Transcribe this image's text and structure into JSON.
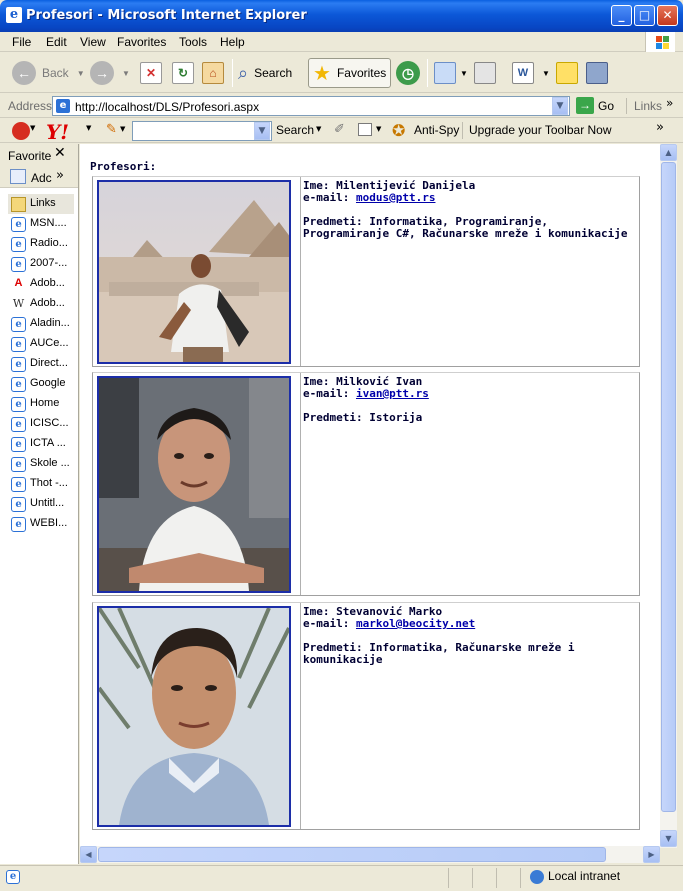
{
  "window": {
    "title": "Profesori - Microsoft Internet Explorer"
  },
  "menu": {
    "items": [
      "File",
      "Edit",
      "View",
      "Favorites",
      "Tools",
      "Help"
    ]
  },
  "toolbar": {
    "back": "Back",
    "search": "Search",
    "favorites": "Favorites"
  },
  "address": {
    "label": "Address",
    "url": "http://localhost/DLS/Profesori.aspx",
    "go": "Go",
    "links": "Links"
  },
  "yahoo": {
    "search": "Search",
    "antispy": "Anti-Spy",
    "upgrade": "Upgrade your Toolbar Now"
  },
  "favorites_pane": {
    "title": "Favorite",
    "add": "Adc",
    "items": [
      "Links",
      "MSN....",
      "Radio...",
      "2007-...",
      "Adob...",
      "Adob...",
      "Aladin...",
      "AUCe...",
      "Direct...",
      "Google",
      "Home",
      "ICISC...",
      "ICTA ...",
      "Skole ...",
      "Thot -...",
      "Untitl...",
      "WEBI..."
    ]
  },
  "page": {
    "heading": "Profesori:",
    "professors": [
      {
        "ime_label": "Ime:",
        "name": "Milentijević Danijela",
        "email_label": "e-mail:",
        "email": "modus@ptt.rs",
        "predmeti_label": "Predmeti:",
        "predmeti": "Informatika, Programiranje, Programiranje C#, Računarske mreže i komunikacije"
      },
      {
        "ime_label": "Ime:",
        "name": "Milković Ivan",
        "email_label": "e-mail:",
        "email": "ivan@ptt.rs",
        "predmeti_label": "Predmeti:",
        "predmeti": "Istorija"
      },
      {
        "ime_label": "Ime:",
        "name": "Stevanović Marko",
        "email_label": "e-mail:",
        "email": "markol@beocity.net",
        "predmeti_label": "Predmeti:",
        "predmeti": "Informatika, Računarske mreže i komunikacije"
      }
    ]
  },
  "status": {
    "zone": "Local intranet"
  },
  "colors": {
    "titlebar": "#0846c4",
    "photo_border": "#1c2ea8",
    "link": "#0000aa",
    "text": "#000033"
  }
}
